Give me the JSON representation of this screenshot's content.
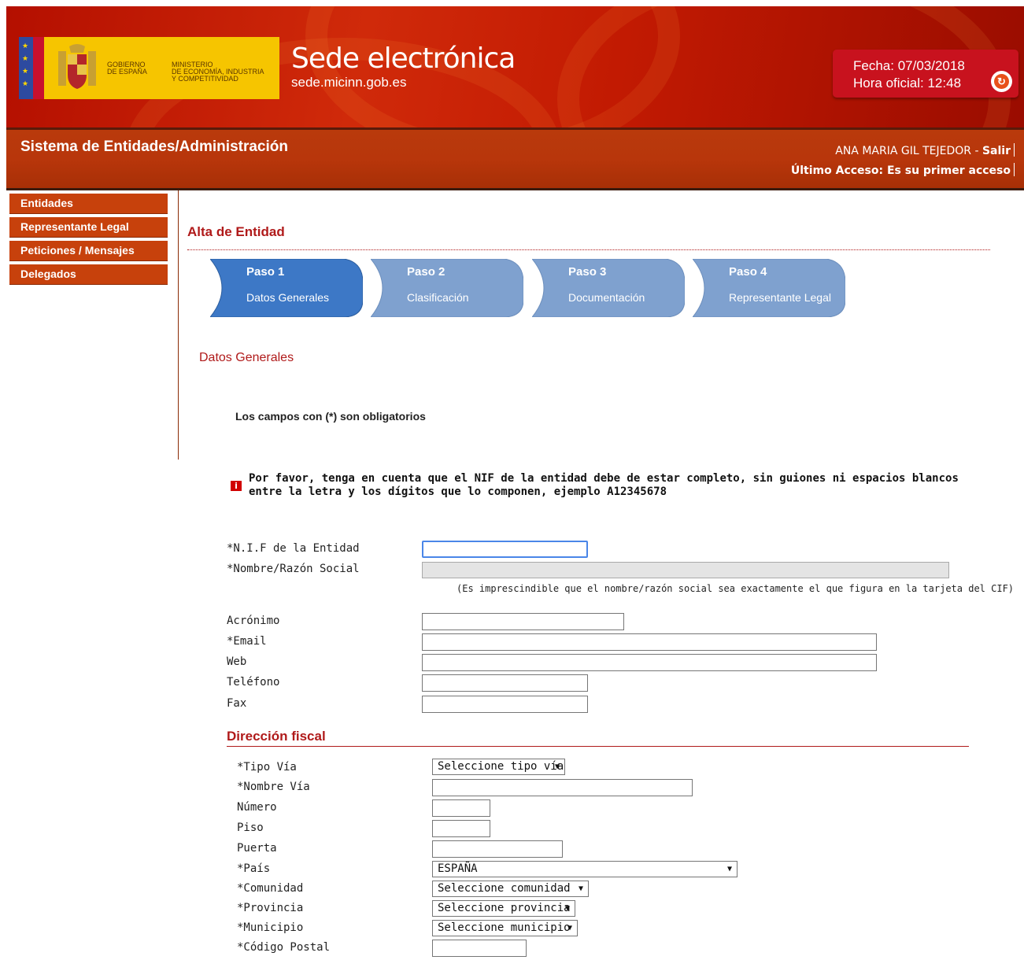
{
  "header": {
    "gobierno": "GOBIERNO\nDE ESPAÑA",
    "ministerio": "MINISTERIO\nDE ECONOMÍA, INDUSTRIA\nY COMPETITIVIDAD",
    "site_title": "Sede electrónica",
    "site_url": "sede.micinn.gob.es",
    "fecha": "Fecha: 07/03/2018",
    "hora": "Hora oficial: 12:48",
    "system_title": "Sistema de Entidades/Administración",
    "user_name": "ANA MARIA GIL TEJEDOR - ",
    "logout": "Salir",
    "last_access": "Último Acceso: Es su primer acceso"
  },
  "sidebar": {
    "items": [
      {
        "label": "Entidades"
      },
      {
        "label": "Representante Legal"
      },
      {
        "label": "Peticiones / Mensajes"
      },
      {
        "label": "Delegados"
      }
    ]
  },
  "main": {
    "page_title": "Alta de Entidad",
    "steps": [
      {
        "title": "Paso 1",
        "subtitle": "Datos Generales"
      },
      {
        "title": "Paso 2",
        "subtitle": "Clasificación"
      },
      {
        "title": "Paso 3",
        "subtitle": "Documentación"
      },
      {
        "title": "Paso 4",
        "subtitle": "Representante Legal"
      }
    ],
    "section_title": "Datos Generales",
    "required_note": "Los campos con (*) son obligatorios",
    "info_message": "Por favor, tenga en cuenta que el NIF de la entidad debe de estar completo, sin guiones ni espacios blancos entre la letra y los dígitos que lo componen, ejemplo A12345678",
    "fields": {
      "nif": "*N.I.F de la Entidad",
      "nombre": "*Nombre/Razón Social",
      "cif_note": "(Es imprescindible que el nombre/razón social sea exactamente el que figura en la tarjeta del CIF)",
      "acronimo": "Acrónimo",
      "email": "*Email",
      "web": "Web",
      "telefono": "Teléfono",
      "fax": "Fax"
    },
    "fiscal": {
      "title": "Dirección fiscal",
      "tipo_via": "*Tipo Vía",
      "tipo_via_value": "Seleccione tipo vía",
      "nombre_via": "*Nombre Vía",
      "numero": "Número",
      "piso": "Piso",
      "puerta": "Puerta",
      "pais": "*País",
      "pais_value": "ESPAÑA",
      "comunidad": "*Comunidad",
      "comunidad_value": "Seleccione comunidad",
      "provincia": "*Provincia",
      "provincia_value": "Seleccione provincia",
      "municipio": "*Municipio",
      "municipio_value": "Seleccione municipio",
      "codigo_postal": "*Código Postal"
    }
  },
  "colors": {
    "header_red": "#c21a02",
    "step_active": "#3d78c6",
    "step_inactive": "#7fa1cf",
    "title_red": "#b01a1a"
  }
}
